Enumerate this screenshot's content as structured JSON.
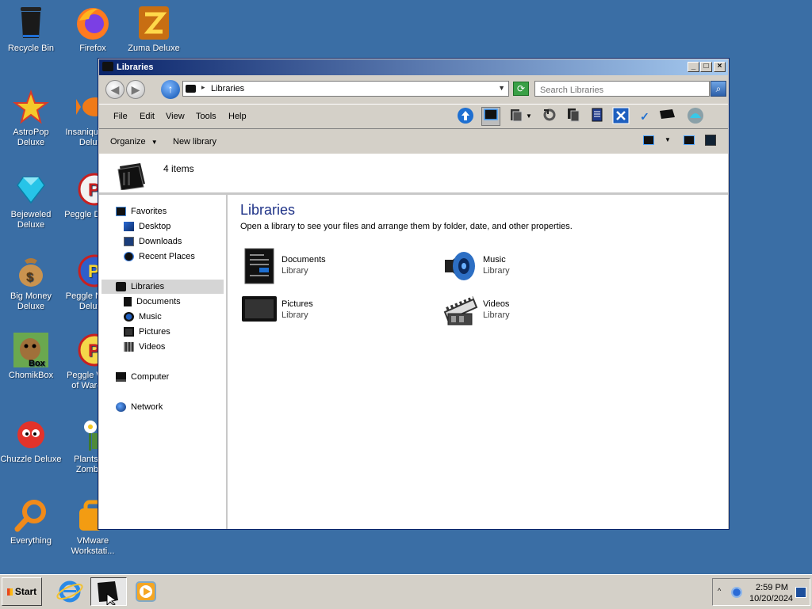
{
  "desktop": {
    "icons": [
      {
        "label": "Recycle Bin",
        "icon": "recycle-bin-icon"
      },
      {
        "label": "Firefox",
        "icon": "firefox-icon"
      },
      {
        "label": "Zuma Deluxe",
        "icon": "zuma-icon"
      },
      {
        "label": "AstroPop Deluxe",
        "icon": "astropop-icon"
      },
      {
        "label": "Insaniquarium Deluxe",
        "icon": "insaniquarium-icon"
      },
      {
        "label": "Bejeweled Deluxe",
        "icon": "bejeweled-icon"
      },
      {
        "label": "Peggle Deluxe",
        "icon": "peggle-icon"
      },
      {
        "label": "Big Money Deluxe",
        "icon": "big-money-icon"
      },
      {
        "label": "Peggle Nights Deluxe",
        "icon": "peggle-nights-icon"
      },
      {
        "label": "ChomikBox",
        "icon": "chomikbox-icon"
      },
      {
        "label": "Peggle World of Warcraft",
        "icon": "peggle-wow-icon"
      },
      {
        "label": "Chuzzle Deluxe",
        "icon": "chuzzle-icon"
      },
      {
        "label": "Plants vs. Zombies",
        "icon": "pvz-icon"
      },
      {
        "label": "Everything",
        "icon": "everything-icon"
      },
      {
        "label": "VMware Workstati...",
        "icon": "vmware-icon"
      }
    ]
  },
  "window": {
    "title": "Libraries",
    "address": {
      "path": "Libraries"
    },
    "search": {
      "placeholder": "Search Libraries"
    },
    "menu": [
      "File",
      "Edit",
      "View",
      "Tools",
      "Help"
    ],
    "commands": {
      "organize": "Organize",
      "new_library": "New library"
    },
    "details": {
      "count": "4 items"
    },
    "nav": {
      "favorites": {
        "label": "Favorites",
        "items": [
          "Desktop",
          "Downloads",
          "Recent Places"
        ]
      },
      "libraries": {
        "label": "Libraries",
        "items": [
          "Documents",
          "Music",
          "Pictures",
          "Videos"
        ]
      },
      "computer": "Computer",
      "network": "Network"
    },
    "content": {
      "heading": "Libraries",
      "description": "Open a library to see your files and arrange them by folder, date, and other properties.",
      "libraries": [
        {
          "name": "Documents",
          "type": "Library",
          "icon": "documents-library-icon"
        },
        {
          "name": "Music",
          "type": "Library",
          "icon": "music-library-icon"
        },
        {
          "name": "Pictures",
          "type": "Library",
          "icon": "pictures-library-icon"
        },
        {
          "name": "Videos",
          "type": "Library",
          "icon": "videos-library-icon"
        }
      ]
    }
  },
  "taskbar": {
    "start": "Start",
    "clock": {
      "time": "2:59 PM",
      "date": "10/20/2024"
    }
  },
  "colors": {
    "desktop": "#3a6ea5",
    "title_gradient_start": "#0a246a",
    "title_gradient_end": "#a6caf0",
    "heading": "#1e3287"
  }
}
